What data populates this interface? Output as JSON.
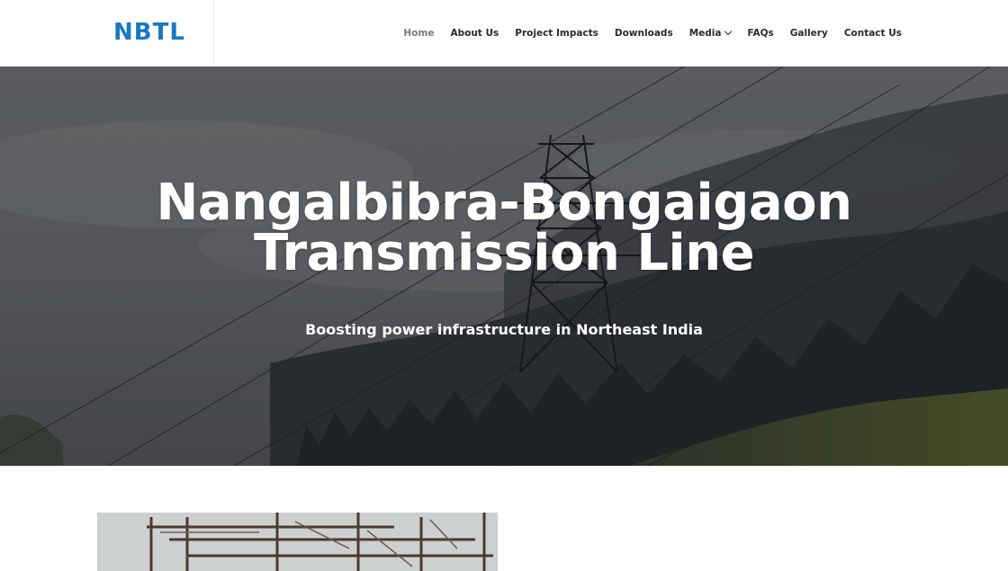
{
  "header": {
    "logo_text": "NBTL",
    "nav": [
      {
        "label": "Home",
        "active": true
      },
      {
        "label": "About Us"
      },
      {
        "label": "Project Impacts"
      },
      {
        "label": "Downloads"
      },
      {
        "label": "Media",
        "has_dropdown": true
      },
      {
        "label": "FAQs"
      },
      {
        "label": "Gallery"
      },
      {
        "label": "Contact Us"
      }
    ]
  },
  "hero": {
    "title": "Nangalbibra-Bongaigaon Transmission Line",
    "subtitle": "Boosting power infrastructure in Northeast India"
  },
  "colors": {
    "brand": "#1a78c0",
    "nav_text": "#2b2b2b",
    "nav_active": "#7a7a7a",
    "hero_text": "#ffffff"
  }
}
